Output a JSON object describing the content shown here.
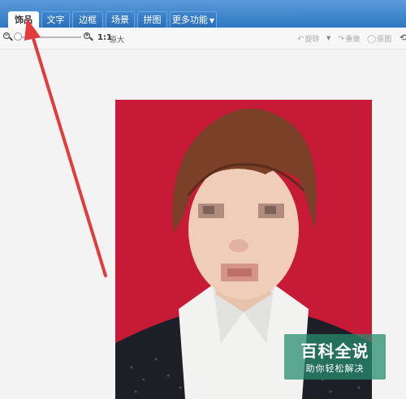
{
  "tabs": [
    {
      "label": "饰品",
      "active": true
    },
    {
      "label": "文字",
      "active": false
    },
    {
      "label": "边框",
      "active": false
    },
    {
      "label": "场景",
      "active": false
    },
    {
      "label": "拼图",
      "active": false
    },
    {
      "label": "更多功能",
      "active": false,
      "dropdown": true
    }
  ],
  "toolbar": {
    "zoom_out_icon": "zoom-out-icon",
    "zoom_in_icon": "zoom-in-icon",
    "ratio": "1:1",
    "ratio_label": "原大",
    "rotate_label": "旋转",
    "redo_label": "重做",
    "original_label": "原图"
  },
  "watermark": {
    "title": "百科全说",
    "subtitle": "助你轻松解决"
  },
  "colors": {
    "tabbar": "#2f78c2",
    "photo_background": "#c61a36",
    "arrow": "#e23b3b",
    "watermark": "#2a8c6e"
  }
}
